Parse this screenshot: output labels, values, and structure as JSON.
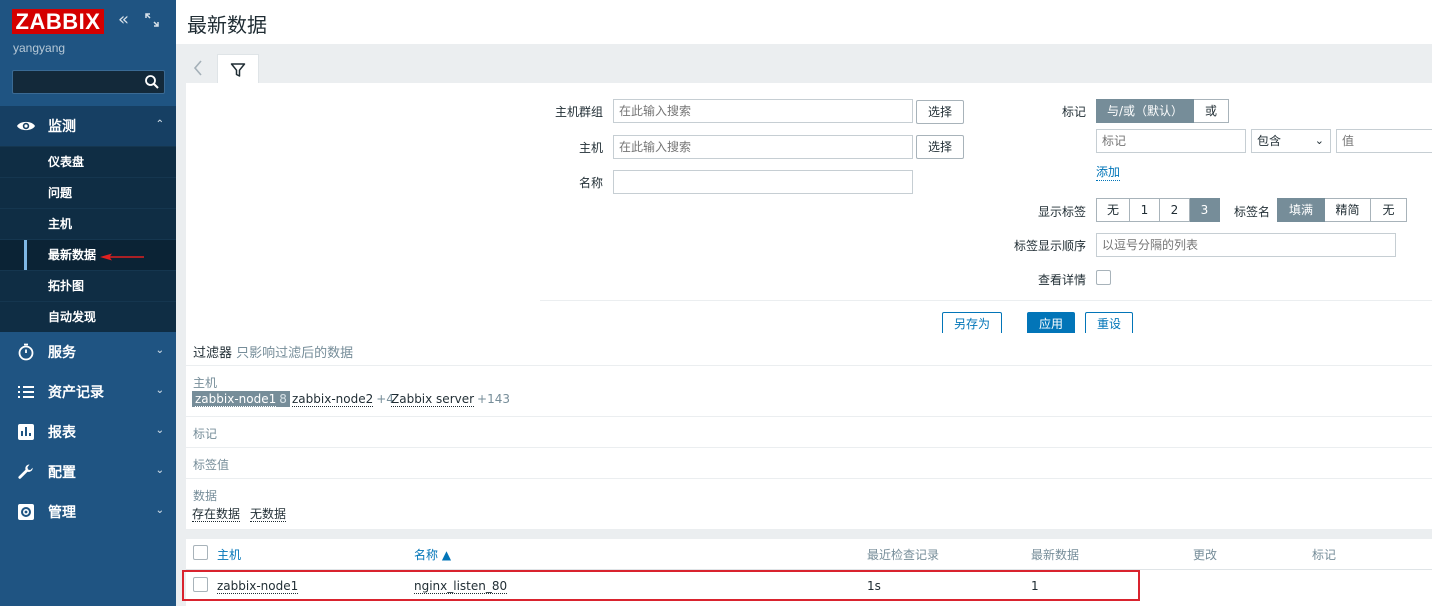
{
  "sidebar": {
    "logo": "ZABBIX",
    "user": "yangyang",
    "search_placeholder": "",
    "items": [
      {
        "label": "监测",
        "icon": "eye-icon"
      },
      {
        "label": "服务",
        "icon": "clock-icon"
      },
      {
        "label": "资产记录",
        "icon": "list-icon"
      },
      {
        "label": "报表",
        "icon": "bar-chart-icon"
      },
      {
        "label": "配置",
        "icon": "wrench-icon"
      },
      {
        "label": "管理",
        "icon": "gear-icon"
      }
    ],
    "submenu": [
      "仪表盘",
      "问题",
      "主机",
      "最新数据",
      "拓扑图",
      "自动发现"
    ]
  },
  "header": {
    "title": "最新数据"
  },
  "filter": {
    "host_groups_label": "主机群组",
    "host_groups_placeholder": "在此输入搜索",
    "hosts_label": "主机",
    "hosts_placeholder": "在此输入搜索",
    "name_label": "名称",
    "name_value": "",
    "select_label": "选择",
    "tags_label": "标记",
    "and_or_label": "与/或（默认）",
    "or_label": "或",
    "tag_placeholder": "标记",
    "operator_value": "包含",
    "value_placeholder": "值",
    "add_label": "添加",
    "show_tags_label": "显示标签",
    "show_tags_options": [
      "无",
      "1",
      "2",
      "3"
    ],
    "tag_name_label": "标签名",
    "tag_name_options": [
      "填满",
      "精简",
      "无"
    ],
    "tag_order_label": "标签显示顺序",
    "tag_order_placeholder": "以逗号分隔的列表",
    "details_label": "查看详情",
    "save_as_label": "另存为",
    "apply_label": "应用",
    "reset_label": "重设"
  },
  "subfilter": {
    "title": "过滤器",
    "subtitle": "只影响过滤后的数据",
    "hosts_label": "主机",
    "hosts": [
      {
        "name": "zabbix-node1",
        "count": "8"
      },
      {
        "name": "zabbix-node2",
        "count": "+4"
      },
      {
        "name": "Zabbix server",
        "count": "+143"
      }
    ],
    "tags_label": "标记",
    "tag_values_label": "标签值",
    "data_label": "数据",
    "data_options": [
      "存在数据",
      "无数据"
    ]
  },
  "table": {
    "columns": [
      "主机",
      "名称 ▲",
      "最近检查记录",
      "最新数据",
      "更改",
      "标记"
    ],
    "rows": [
      {
        "host": "zabbix-node1",
        "name": "nginx_listen_80",
        "last_check": "1s",
        "last_value": "1",
        "change": "",
        "tags": ""
      }
    ]
  }
}
